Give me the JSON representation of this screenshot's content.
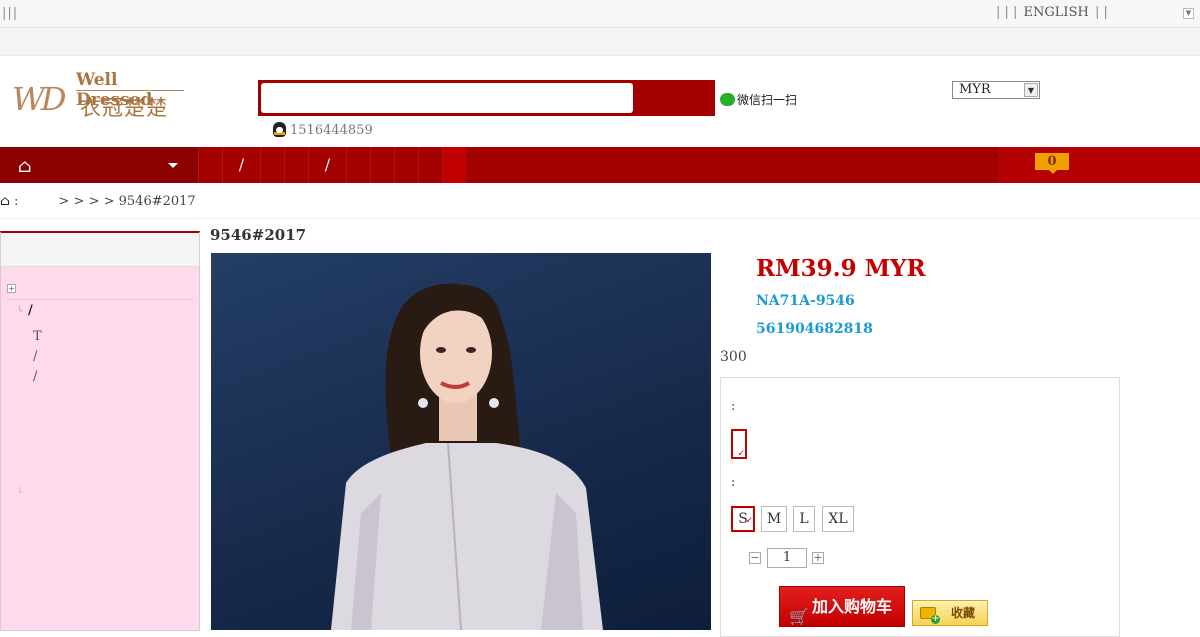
{
  "topbar": {
    "left_text": "|||",
    "right_pre": "|   |   |",
    "lang": "ENGLISH",
    "right_post": "|   |"
  },
  "logo": {
    "mark": "WD",
    "en": "Well Dressed",
    "cn": "衣冠楚楚"
  },
  "search": {
    "placeholder": ""
  },
  "wechat": {
    "label": "微信扫一扫"
  },
  "qq": {
    "number": "1516444859"
  },
  "currency": {
    "selected": "MYR"
  },
  "nav": {
    "sep1": "/",
    "sep2": "/",
    "cart_count": "0"
  },
  "breadcrumb": {
    "colon": ":",
    "trail": "> > > > 9546#2017"
  },
  "sidebar": {
    "item1": "/",
    "item2": "T",
    "item3": "/",
    "item4": "/"
  },
  "product": {
    "title": "9546#2017",
    "price": "RM39.9 MYR",
    "code1": "NA71A-9546",
    "code2": "561904682818",
    "stock": "300",
    "color_label": ":",
    "size_label": ":",
    "sizes": [
      "S",
      "M",
      "L",
      "XL"
    ],
    "quantity": "1",
    "add_to_cart": "加入购物车",
    "favorite": "收藏"
  },
  "colors": {
    "accent": "#a30000",
    "price": "#c40000",
    "link": "#1a9ad6",
    "sidebar_bg": "#ffd9ec"
  }
}
